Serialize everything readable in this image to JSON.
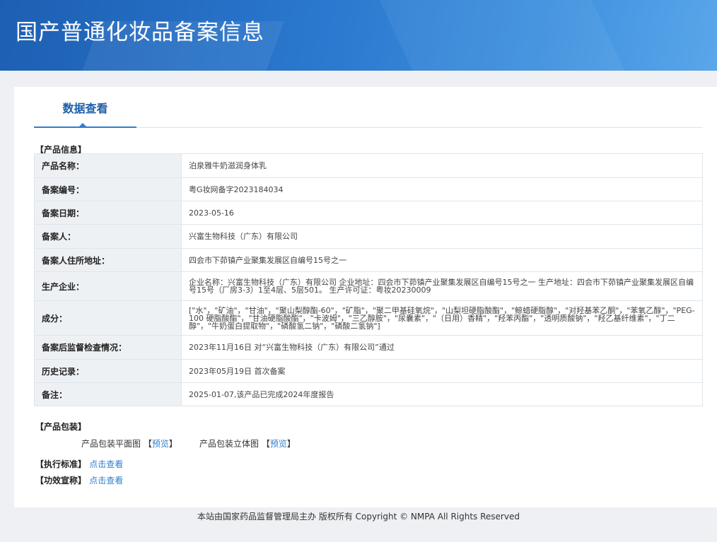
{
  "header": {
    "title": "国产普通化妆品备案信息"
  },
  "tabs": [
    {
      "label": "数据查看"
    }
  ],
  "product_section": {
    "label": "【产品信息】"
  },
  "product_info": [
    {
      "key": "产品名称：",
      "value": "泊泉雅牛奶滋润身体乳"
    },
    {
      "key": "备案编号：",
      "value": "粤G妆网备字2023184034"
    },
    {
      "key": "备案日期：",
      "value": "2023-05-16"
    },
    {
      "key": "备案人：",
      "value": "兴富生物科技（广东）有限公司"
    },
    {
      "key": "备案人住所地址：",
      "value": "四会市下茆镇产业聚集发展区自编号15号之一"
    },
    {
      "key": "生产企业：",
      "value": "企业名称：兴富生物科技（广东）有限公司 企业地址：四会市下茆镇产业聚集发展区自编号15号之一 生产地址：四会市下茆镇产业聚集发展区自编号15号（厂房3-3）1至4层、5层501。 生产许可证：粤妆20230009"
    },
    {
      "key": "成分：",
      "value": "[\"水\"，\"矿油\"，\"甘油\"，\"聚山梨醇酯-60\"，\"矿脂\"，\"聚二甲基硅氧烷\"，\"山梨坦硬脂酸酯\"，\"鲸蜡硬脂醇\"，\"对羟基苯乙酮\"，\"苯氧乙醇\"，\"PEG-100 硬脂酸酯\"，\"甘油硬脂酸酯\"，\"卡波姆\"，\"三乙醇胺\"，\"尿囊素\"，\"（日用）香精\"，\"羟苯丙酯\"，\"透明质酸钠\"，\"羟乙基纤维素\"，\"丁二醇\"，\"牛奶蛋白提取物\"，\"磷酸氢二钠\"，\"磷酸二氢钠\"]"
    },
    {
      "key": "备案后监督检查情况：",
      "value": "2023年11月16日 对“兴富生物科技（广东）有限公司”通过"
    },
    {
      "key": "历史记录：",
      "value": "2023年05月19日 首次备案"
    },
    {
      "key": "备注：",
      "value": "2025-01-07,该产品已完成2024年度报告"
    }
  ],
  "packaging": {
    "label": "【产品包装】",
    "flat_label": "产品包装平面图",
    "stereo_label": "产品包装立体图",
    "preview_open": "【",
    "preview_text": "预览",
    "preview_close": "】"
  },
  "standard": {
    "label": "【执行标准】",
    "link": "点击查看"
  },
  "efficacy": {
    "label": "【功效宣称】",
    "link": "点击查看"
  },
  "footer": {
    "text": "本站由国家药品监督管理局主办 版权所有 Copyright © NMPA All Rights Reserved"
  }
}
